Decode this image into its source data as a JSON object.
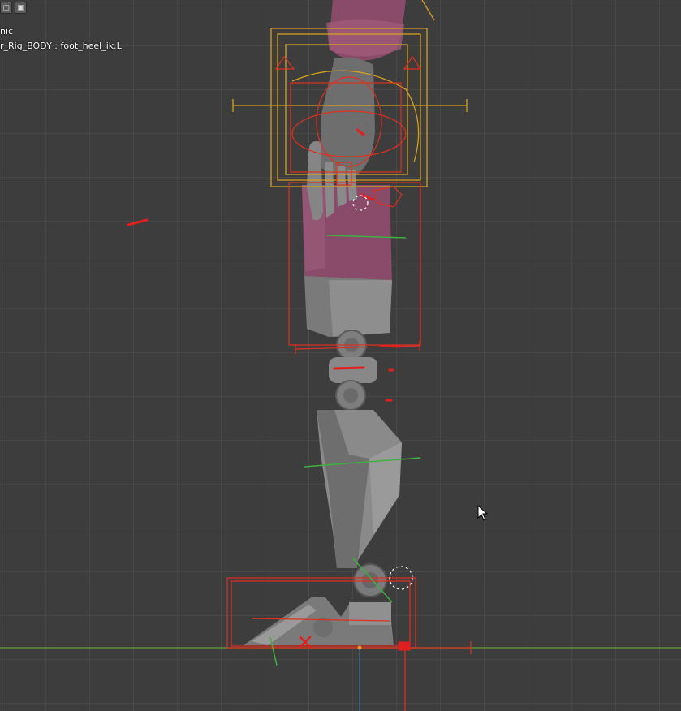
{
  "viewport": {
    "mode_label": "nic",
    "active_object_label": "r_Rig_BODY : foot_heel_ik.L"
  },
  "header_tools": [
    {
      "name": "overlay-toggle-icon",
      "glyph": "▢"
    },
    {
      "name": "xray-toggle-icon",
      "glyph": "▣"
    }
  ],
  "colors": {
    "background": "#3d3d3d",
    "grid": "#505050",
    "x_axis": "#6a9a3a",
    "z_axis": "#3a6ab0",
    "selected_bone": "#e03020",
    "bone_yellow": "#d4a020",
    "body_fabric": "#8a4a6a",
    "robot_metal": "#7c7c7c"
  },
  "cursor": {
    "name": "mouse-pointer-icon"
  }
}
